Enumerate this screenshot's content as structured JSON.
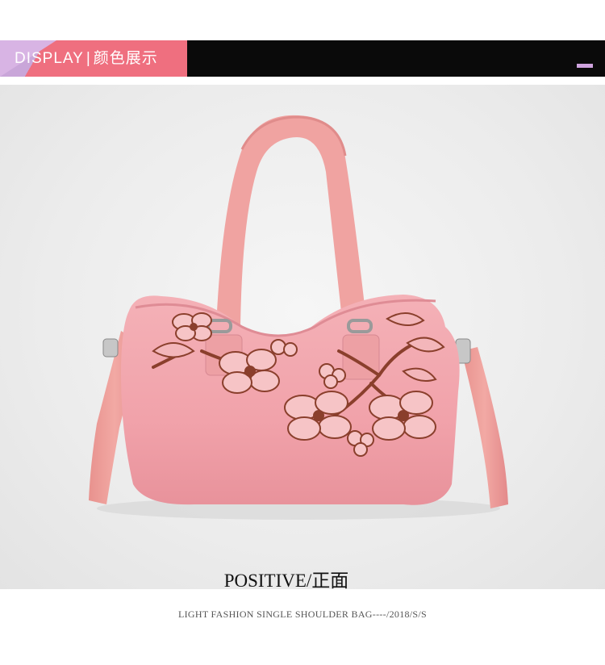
{
  "header": {
    "label_en": "DISPLAY",
    "separator": "|",
    "label_cn": "颜色展示",
    "colors": {
      "bar": "#0a0a0a",
      "badge": "#ef6f7f",
      "badge_corner": "#d8b4e4",
      "accent": "#cfa3de"
    }
  },
  "product_image": {
    "subject": "pink nylon shoulder handbag with brown floral embroidery",
    "colors": {
      "bag": "#f2a7ae",
      "strap": "#ec9d99",
      "embroidery": "#8a3f2c"
    }
  },
  "caption": {
    "title": "POSITIVE/正面",
    "subtitle": "LIGHT FASHION SINGLE SHOULDER BAG----/2018/S/S"
  }
}
